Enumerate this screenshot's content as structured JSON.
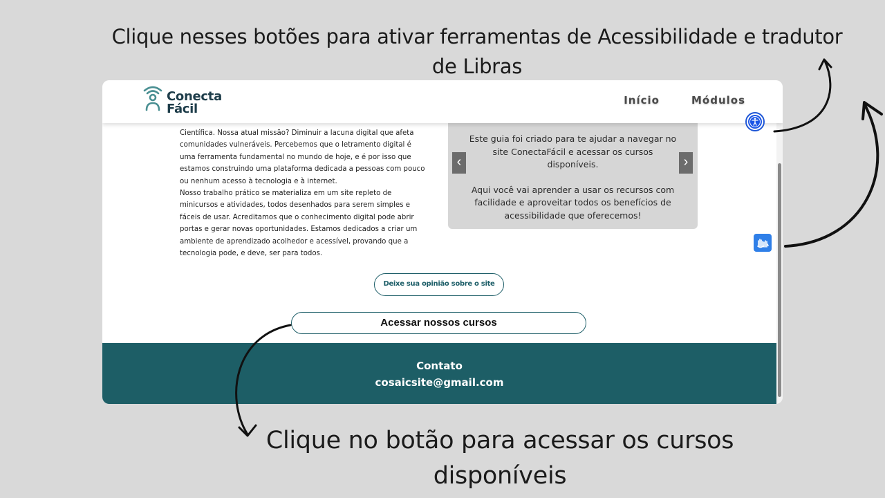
{
  "captions": {
    "top": "Clique nesses botões para ativar ferramentas de Acessibilidade e tradutor de Libras",
    "bottom": "Clique no botão para acessar os cursos disponíveis"
  },
  "site": {
    "logo": {
      "line1": "Conecta",
      "line2": "Fácil"
    },
    "nav": {
      "inicio": "Início",
      "modulos": "Módulos"
    },
    "about": {
      "p1": "Científica. Nossa atual missão? Diminuir a lacuna digital que afeta comunidades vulneráveis. Percebemos que o letramento digital é uma ferramenta fundamental no mundo de hoje, e é por isso que estamos construindo uma plataforma dedicada a pessoas com pouco ou nenhum acesso à tecnologia e à internet.",
      "p2": "Nosso trabalho prático se materializa em um site repleto de minicursos e atividades, todos desenhados para serem simples e fáceis de usar. Acreditamos que o conhecimento digital pode abrir portas e gerar novas oportunidades. Estamos dedicados a criar um ambiente de aprendizado acolhedor e acessível, provando que a tecnologia pode, e deve, ser para todos."
    },
    "guide": {
      "p1": "Este guia foi criado para te ajudar a navegar no site ConectaFácil e acessar os cursos disponíveis.",
      "p2": "Aqui você vai aprender a usar os recursos com facilidade e aproveitar todos os benefícios de acessibilidade que oferecemos!",
      "prev": "‹",
      "next": "›"
    },
    "buttons": {
      "opinion": "Deixe sua opinião sobre o site",
      "courses": "Acessar nossos cursos"
    },
    "footer": {
      "title": "Contato",
      "email": "cosaicsite@gmail.com"
    },
    "icons": {
      "accessibility": "accessibility-icon",
      "libras": "libras-hands-icon"
    }
  },
  "colors": {
    "background": "#d9d9d9",
    "teal": "#1d5e66",
    "accessibility_blue": "#1a54e6",
    "libras_blue": "#2f7fe8",
    "guide_box": "#d6d6d6"
  }
}
